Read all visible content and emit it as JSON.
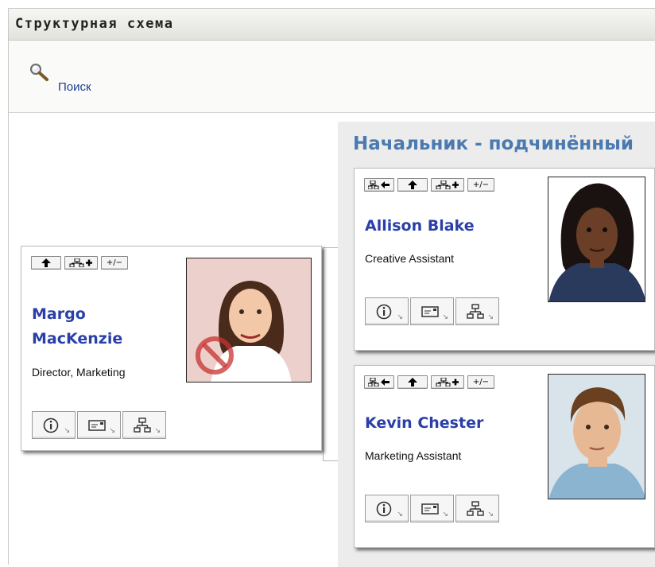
{
  "window": {
    "title": "Структурная схема"
  },
  "search": {
    "label": "Поиск"
  },
  "panel": {
    "title": "Начальник - подчинённый"
  },
  "manager": {
    "name_line1": "Margo",
    "name_line2": "MacKenzie",
    "job_title": "Director, Marketing",
    "toolbar": [
      "up-arrow",
      "add-org-chart",
      "expand-collapse"
    ],
    "photo_note": "restricted-photo"
  },
  "reports": [
    {
      "name": "Allison Blake",
      "job_title": "Creative Assistant",
      "toolbar": [
        "go-to-manager",
        "up-arrow",
        "add-org-chart",
        "expand-collapse"
      ]
    },
    {
      "name": "Kevin Chester",
      "job_title": "Marketing Assistant",
      "toolbar": [
        "go-to-manager",
        "up-arrow",
        "add-org-chart",
        "expand-collapse"
      ]
    }
  ],
  "toolbar_labels": {
    "expand_collapse": "+/−"
  },
  "actions": [
    "info-icon",
    "email-icon",
    "org-chart-icon"
  ],
  "colors": {
    "name_link": "#2a3fa8",
    "panel_title": "#4a7ab0",
    "search_link": "#1f3f8f"
  }
}
